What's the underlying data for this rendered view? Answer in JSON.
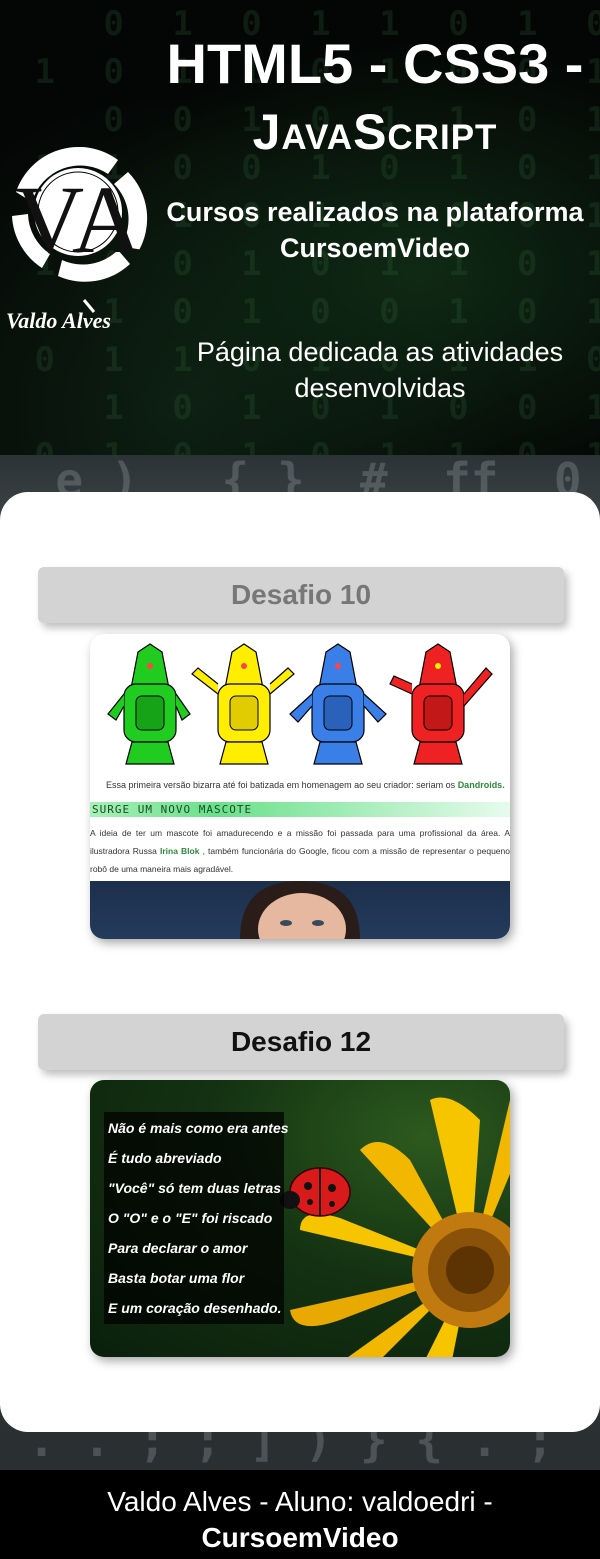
{
  "header": {
    "title_line1": "HTML5 - CSS3 -",
    "title_line2": "JavaScript",
    "subtitle": "Cursos realizados na plataforma CursoemVideo",
    "intro": "Página dedicada as atividades desenvolvidas",
    "logo": {
      "monogram": "VA",
      "caption": "Valdo Alves",
      "icon": "va-monogram-logo"
    }
  },
  "challenges": [
    {
      "title": "Desafio 10",
      "preview": {
        "icon": "android-mascots-image",
        "caption_text": "Essa primeira versão bizarra até foi batizada em homenagem ao seu criador: seriam os",
        "caption_highlight": "Dandroids.",
        "banner": "SURGE UM NOVO MASCOTE",
        "paragraph_start": "A ideia de ter um mascote foi amadurecendo e a missão foi passada para uma profissional da área. A ilustradora Russa",
        "paragraph_highlight": "Irina Blok",
        "paragraph_end": ", também funcionária do Google, ficou com a missão de representar o pequeno robô de uma maneira mais agradável."
      }
    },
    {
      "title": "Desafio 12",
      "preview": {
        "icon": "ladybug-flower-image",
        "poem": [
          "Não é mais como era antes",
          "É tudo abreviado",
          "\"Você\" só tem duas letras",
          "O \"O\" e o \"E\" foi riscado",
          "Para declarar o amor",
          "Basta botar uma flor",
          "E um coração desenhado."
        ]
      }
    }
  ],
  "footer": {
    "line1": "Valdo Alves - Aluno: valdoedri -",
    "line2": "CursoemVideo"
  },
  "colors": {
    "header_bg": "#040605",
    "card_bg": "#ffffff",
    "challenge_title_bg": "#d3d3d3",
    "challenge10_title_text": "#777777",
    "challenge12_title_text": "#111111",
    "footer_bg": "#000000"
  }
}
